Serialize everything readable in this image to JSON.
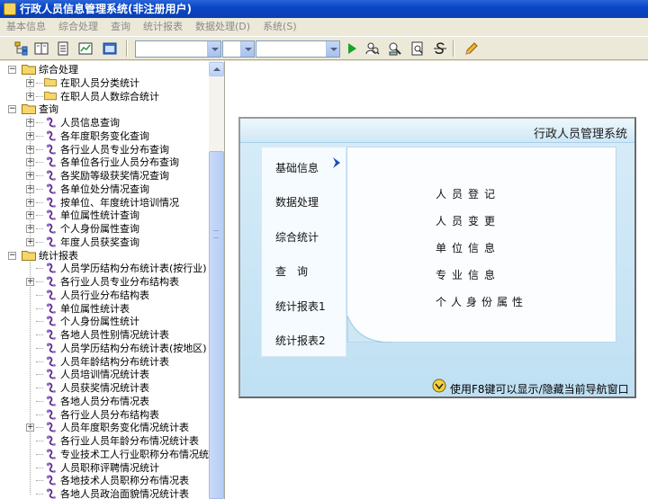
{
  "window": {
    "title": "行政人员信息管理系统(非注册用户)"
  },
  "menu": [
    "基本信息",
    "综合处理",
    "查询",
    "统计报表",
    "数据处理(D)",
    "系统(S)"
  ],
  "tree": {
    "groups": [
      {
        "label": "综合处理",
        "children": [
          "在职人员分类统计",
          "在职人员人数综合统计"
        ]
      },
      {
        "label": "查询",
        "children": [
          "人员信息查询",
          "各年度职务变化查询",
          "各行业人员专业分布查询",
          "各单位各行业人员分布查询",
          "各奖励等级获奖情况查询",
          "各单位处分情况查询",
          "按单位、年度统计培训情况",
          "单位属性统计查询",
          "个人身份属性查询",
          "年度人员获奖查询"
        ]
      },
      {
        "label": "统计报表",
        "children": [
          "人员学历结构分布统计表(按行业)",
          "各行业人员专业分布结构表",
          "人员行业分布结构表",
          "单位属性统计表",
          "个人身份属性统计",
          "各地人员性别情况统计表",
          "人员学历结构分布统计表(按地区)",
          "人员年龄结构分布统计表",
          "人员培训情况统计表",
          "人员获奖情况统计表",
          "各地人员分布情况表",
          "各行业人员分布结构表",
          "人员年度职务变化情况统计表",
          "各行业人员年龄分布情况统计表",
          "专业技术工人行业职称分布情况统计表",
          "人员职称评聘情况统计",
          "各地技术人员职称分布情况表",
          "各地人员政治面貌情况统计表"
        ]
      }
    ]
  },
  "panel": {
    "title": "行政人员管理系统",
    "nav": [
      "基础信息",
      "数据处理",
      "综合统计",
      "查　询",
      "统计报表1",
      "统计报表2"
    ],
    "items": [
      "人员登记",
      "人员变更",
      "单位信息",
      "专业信息",
      "个人身份属性"
    ],
    "hint": "使用F8键可以显示/隐藏当前导航窗口"
  }
}
